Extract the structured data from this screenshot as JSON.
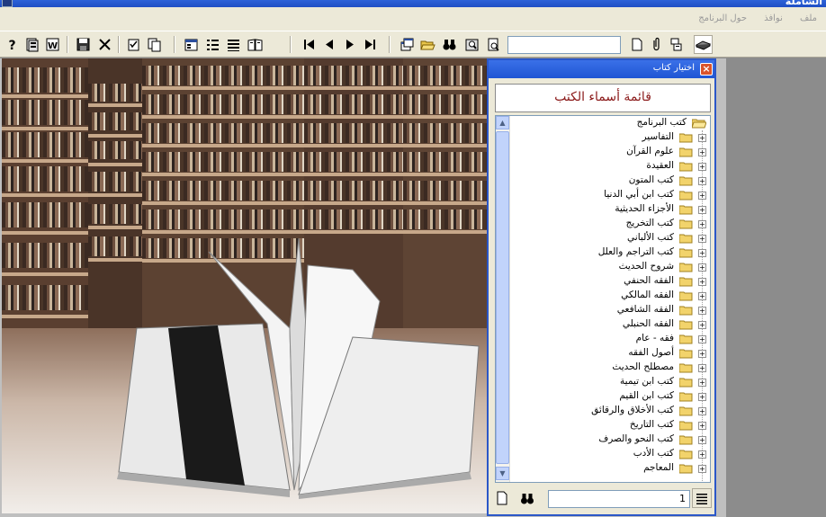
{
  "window": {
    "title": "الشاملة"
  },
  "menu": {
    "items": [
      "ملف",
      "نوافذ",
      "حول البرنامج"
    ]
  },
  "toolbar": {
    "search_value": "",
    "buttons": [
      "help-icon",
      "book-index-icon",
      "word-export-icon",
      "save-icon",
      "delete-icon",
      "edit-icon",
      "copy-icon",
      "properties-icon",
      "list-icon",
      "lines-icon",
      "bookview-icon",
      "first-page-icon",
      "prev-page-icon",
      "next-page-icon",
      "last-page-icon",
      "windows-icon",
      "open-folder-icon",
      "binoculars-icon",
      "search-book-icon",
      "preview-icon",
      "new-page-icon",
      "attach-icon",
      "layout-icon",
      "library-icon"
    ]
  },
  "dialog": {
    "title": "اختيار كتاب",
    "close_label": "×",
    "header": "قائمة أسماء الكتب",
    "tree": {
      "root": "كتب البرنامج",
      "items": [
        "التفاسير",
        "علوم القرآن",
        "العقيدة",
        "كتب المتون",
        "كتب ابن أبي الدنيا",
        "الأجزاء الحديثية",
        "كتب التخريج",
        "كتب الألباني",
        "كتب التراجم والعلل",
        "شروح الحديث",
        "الفقه الحنفي",
        "الفقه المالكي",
        "الفقه الشافعي",
        "الفقه الحنبلي",
        "فقه - عام",
        "أصول الفقه",
        "مصطلح الحديث",
        "كتب ابن تيمية",
        "كتب ابن القيم",
        "كتب الأخلاق والرقائق",
        "كتب التاريخ",
        "كتب النحو والصرف",
        "كتب الأدب",
        "المعاجم"
      ]
    },
    "page_value": "1"
  }
}
